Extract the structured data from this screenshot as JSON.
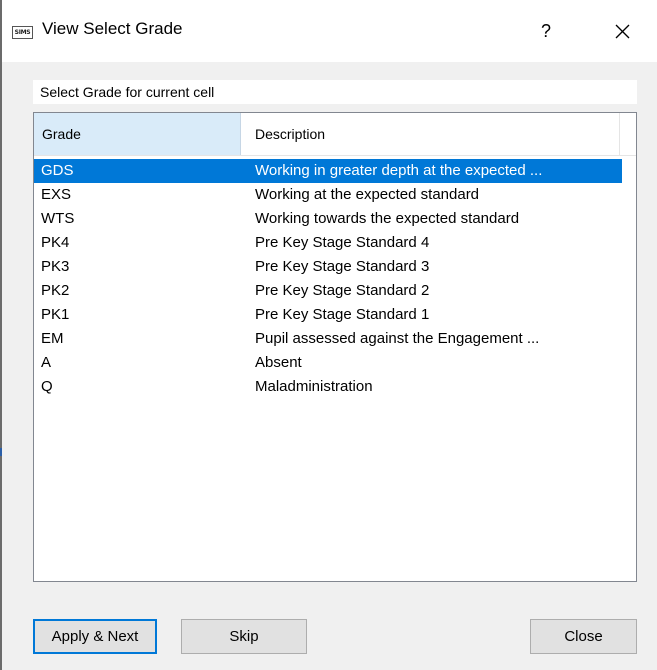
{
  "window": {
    "title": "View Select Grade",
    "app_icon_text": "SIMS",
    "help_label": "?",
    "close_icon": "close-icon"
  },
  "prompt": "Select Grade for current cell",
  "list": {
    "columns": [
      "Grade",
      "Description"
    ],
    "selected_index": 0,
    "rows": [
      {
        "grade": "GDS",
        "description": "Working in greater depth at the expected ..."
      },
      {
        "grade": "EXS",
        "description": "Working at the expected standard"
      },
      {
        "grade": "WTS",
        "description": "Working towards the expected standard"
      },
      {
        "grade": "PK4",
        "description": "Pre Key Stage Standard 4"
      },
      {
        "grade": "PK3",
        "description": "Pre Key Stage Standard 3"
      },
      {
        "grade": "PK2",
        "description": "Pre Key Stage Standard 2"
      },
      {
        "grade": "PK1",
        "description": "Pre Key Stage Standard 1"
      },
      {
        "grade": "EM",
        "description": "Pupil assessed against the Engagement ..."
      },
      {
        "grade": "A",
        "description": "Absent"
      },
      {
        "grade": "Q",
        "description": "Maladministration"
      }
    ]
  },
  "buttons": {
    "apply_next": "Apply & Next",
    "skip": "Skip",
    "close": "Close"
  },
  "colors": {
    "selection": "#0078d7",
    "header_highlight": "#d9ebf9"
  }
}
